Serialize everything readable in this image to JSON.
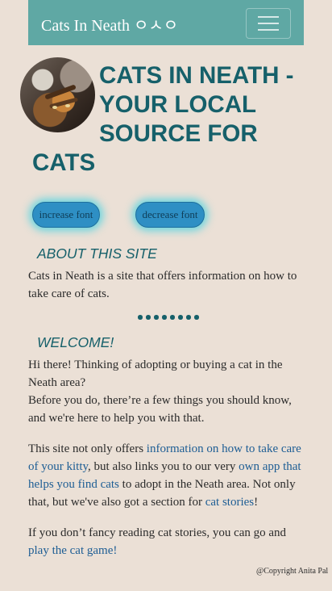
{
  "navbar": {
    "brand": "Cats In Neath ㅇㅅㅇ",
    "toggle_label": "menu"
  },
  "hero": {
    "title_line1": "CATS IN NEATH -",
    "title_line2": "YOUR LOCAL",
    "title_line3": "SOURCE FOR",
    "title_line4": "CATS"
  },
  "controls": {
    "increase_label": "increase font",
    "decrease_label": "decrease font"
  },
  "about": {
    "heading": "ABOUT THIS SITE",
    "text": "Cats in Neath is a site that offers information on how to take care of cats."
  },
  "welcome": {
    "heading": "WELCOME!",
    "line1": "Hi there! Thinking of adopting or buying a cat in the Neath area?",
    "line2": "Before you do, there’re a few things you should know, and we're here to help you with that.",
    "p2_a": "This site not only offers ",
    "p2_link1": "information on how to take care of your kitty",
    "p2_b": ", but also links you to our very ",
    "p2_link2": "own app that helps you find cats",
    "p2_c": " to adopt in the Neath area. Not only that, but we've also got a section for ",
    "p2_link3": "cat stories",
    "p2_d": "!",
    "p3_a": "If you don’t fancy reading cat stories, you can go and ",
    "p3_link": "play the cat game!"
  },
  "footer": {
    "copyright": "@Copyright Anita Pal"
  }
}
